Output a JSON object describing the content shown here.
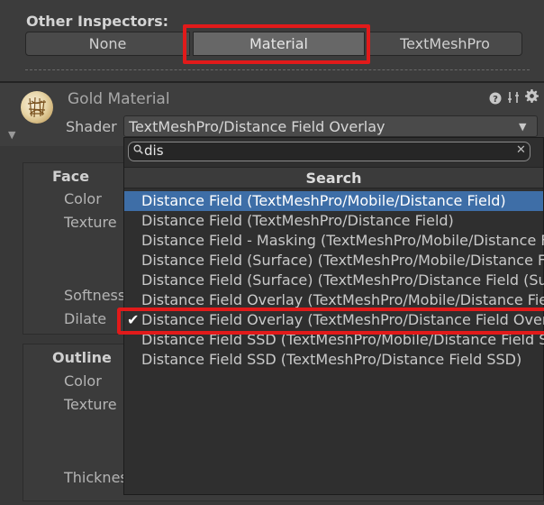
{
  "other_inspectors": {
    "title": "Other Inspectors:",
    "options": [
      "None",
      "Material",
      "TextMeshPro"
    ],
    "selected": "Material"
  },
  "material": {
    "name": "Gold Material",
    "shader_label": "Shader",
    "shader_value": "TextMeshPro/Distance Field Overlay"
  },
  "face": {
    "heading": "Face",
    "props": [
      "Color",
      "Texture",
      "Softness",
      "Dilate"
    ]
  },
  "outline": {
    "heading": "Outline",
    "props": [
      "Color",
      "Texture",
      "Thicknes"
    ]
  },
  "dropdown": {
    "search_value": "dis",
    "header": "Search",
    "items": [
      "Distance Field (TextMeshPro/Mobile/Distance Field)",
      "Distance Field (TextMeshPro/Distance Field)",
      "Distance Field - Masking (TextMeshPro/Mobile/Distance Field - Masking)",
      "Distance Field (Surface) (TextMeshPro/Mobile/Distance Field (Surface))",
      "Distance Field (Surface) (TextMeshPro/Distance Field (Surface))",
      "Distance Field Overlay (TextMeshPro/Mobile/Distance Field Overlay)",
      "Distance Field Overlay (TextMeshPro/Distance Field Overlay)",
      "Distance Field SSD (TextMeshPro/Mobile/Distance Field SSD)",
      "Distance Field SSD (TextMeshPro/Distance Field SSD)"
    ],
    "hover_index": 0,
    "checked_index": 6
  },
  "icons": {
    "help": "help-icon",
    "presets": "sliders-icon",
    "settings": "gear-icon",
    "search": "search-icon",
    "clear": "close-icon",
    "check": "checkmark-icon"
  },
  "colors": {
    "highlight_red": "#e11a1a",
    "selection_blue": "#3e6ea7"
  }
}
